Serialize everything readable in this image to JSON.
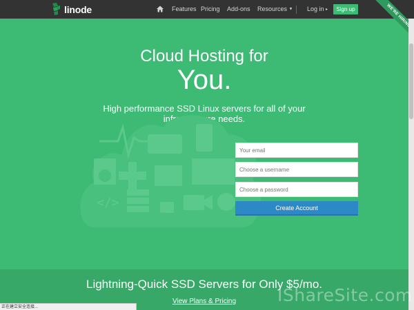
{
  "nav": {
    "brand": "linode",
    "links": [
      "Features",
      "Pricing",
      "Add-ons",
      "Resources"
    ],
    "login": "Log in",
    "signup": "Sign up",
    "ribbon": "WE'RE HIRING!"
  },
  "hero": {
    "title": "Cloud Hosting for",
    "title_big": "You.",
    "subtitle": "High performance SSD Linux servers for all of your infrastructure needs."
  },
  "form": {
    "email_placeholder": "Your email",
    "username_placeholder": "Choose a username",
    "password_placeholder": "Choose a password",
    "submit": "Create Account"
  },
  "band": {
    "title": "Lightning-Quick SSD Servers for Only $5/mo.",
    "link": "View Plans & Pricing"
  },
  "status_bar": "正在建立安全连接...",
  "watermark": "IShareSite.com",
  "colors": {
    "brand_green": "#3dba74",
    "nav_bg": "#333333",
    "button_blue": "#2d89c6"
  }
}
